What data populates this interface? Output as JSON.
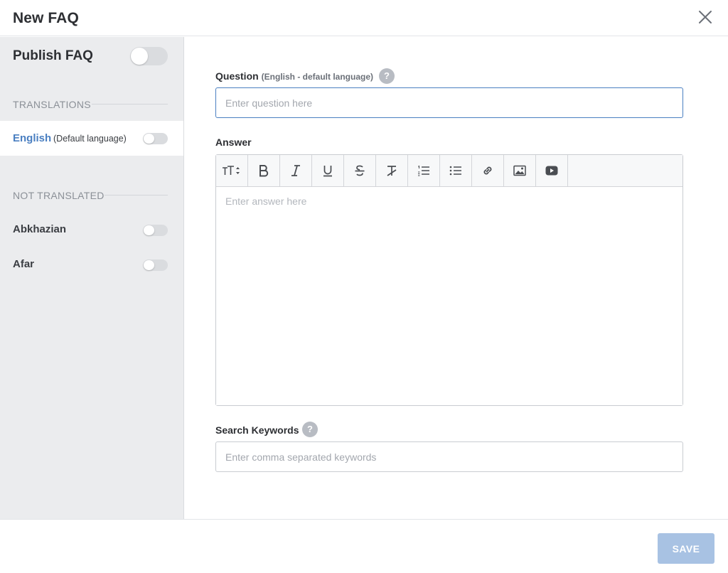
{
  "header": {
    "title": "New FAQ",
    "close_icon": "close-icon"
  },
  "sidebar": {
    "publish_label": "Publish FAQ",
    "publish_enabled": false,
    "translations_heading": "TRANSLATIONS",
    "active_language": {
      "name": "English",
      "note": "(Default language)",
      "enabled": false
    },
    "not_translated_heading": "NOT TRANSLATED",
    "not_translated": [
      {
        "name": "Abkhazian",
        "enabled": false
      },
      {
        "name": "Afar",
        "enabled": false
      }
    ]
  },
  "form": {
    "question": {
      "label": "Question",
      "hint": "(English - default language)",
      "placeholder": "Enter question here",
      "value": ""
    },
    "answer": {
      "label": "Answer",
      "placeholder": "Enter answer here",
      "value": "",
      "toolbar": [
        "font-size-icon",
        "bold-icon",
        "italic-icon",
        "underline-icon",
        "strikethrough-icon",
        "clear-format-icon",
        "ordered-list-icon",
        "unordered-list-icon",
        "link-icon",
        "image-icon",
        "video-icon"
      ]
    },
    "keywords": {
      "label": "Search Keywords",
      "placeholder": "Enter comma separated keywords",
      "value": ""
    },
    "help_glyph": "?"
  },
  "footer": {
    "save_label": "SAVE"
  },
  "colors": {
    "accent": "#4a7fc1",
    "save_disabled": "#a8c2e3",
    "sidebar_bg": "#ebecee"
  }
}
